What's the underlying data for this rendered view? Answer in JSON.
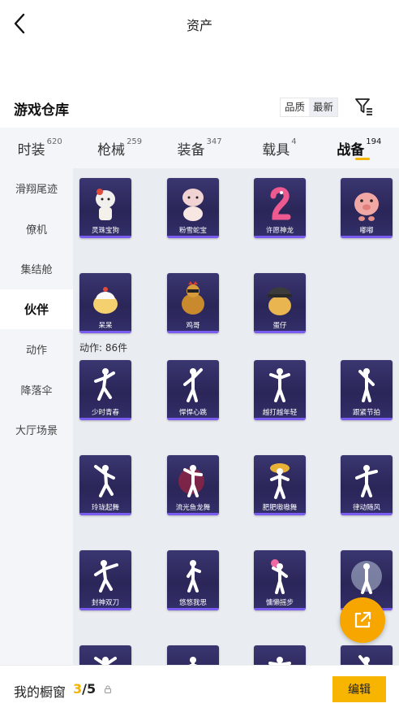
{
  "header": {
    "title": "资产"
  },
  "section": {
    "title": "游戏仓库",
    "sort_options": [
      "品质",
      "最新"
    ],
    "sort_active": "最新"
  },
  "tabs": [
    {
      "label": "时装",
      "count": "620"
    },
    {
      "label": "枪械",
      "count": "259"
    },
    {
      "label": "装备",
      "count": "347"
    },
    {
      "label": "载具",
      "count": "4"
    },
    {
      "label": "战备",
      "count": "194",
      "active": true
    }
  ],
  "sidebar": [
    {
      "label": "滑翔尾迹"
    },
    {
      "label": "僚机"
    },
    {
      "label": "集结舱"
    },
    {
      "label": "伙伴",
      "active": true
    },
    {
      "label": "动作"
    },
    {
      "label": "降落伞"
    },
    {
      "label": "大厅场景"
    }
  ],
  "partners": [
    {
      "name": "灵珠宝狗",
      "icon": "dog-figure"
    },
    {
      "name": "粉雪蛇宝",
      "icon": "snake-figure"
    },
    {
      "name": "许愿神龙",
      "icon": "dragon-figure"
    },
    {
      "name": "嘟嘟",
      "icon": "pig-figure"
    },
    {
      "name": "呆呆",
      "icon": "chick-figure"
    },
    {
      "name": "鸡哥",
      "icon": "rooster-figure"
    },
    {
      "name": "蛋仔",
      "icon": "helmet-chick-figure"
    }
  ],
  "actions": {
    "label": "动作: 86件",
    "items": [
      {
        "name": "少时青春"
      },
      {
        "name": "悍悍心跳"
      },
      {
        "name": "越打越年轻"
      },
      {
        "name": "跟紧节拍"
      },
      {
        "name": "玲珑起舞"
      },
      {
        "name": "流光鱼龙舞"
      },
      {
        "name": "肥肥嗷嗷舞"
      },
      {
        "name": "律动随风"
      },
      {
        "name": "封神双刀"
      },
      {
        "name": "悠悠我思"
      },
      {
        "name": "慵懒摇步"
      },
      {
        "name": ""
      },
      {
        "name": ""
      },
      {
        "name": ""
      },
      {
        "name": ""
      },
      {
        "name": ""
      }
    ]
  },
  "bottom": {
    "wardrobe_label": "我的橱窗",
    "current": "3",
    "total": "/5",
    "edit_label": "编辑"
  },
  "colors": {
    "accent": "#f7b500",
    "card_bg": "#2a2658",
    "card_stripe": "#7b5cf0"
  }
}
